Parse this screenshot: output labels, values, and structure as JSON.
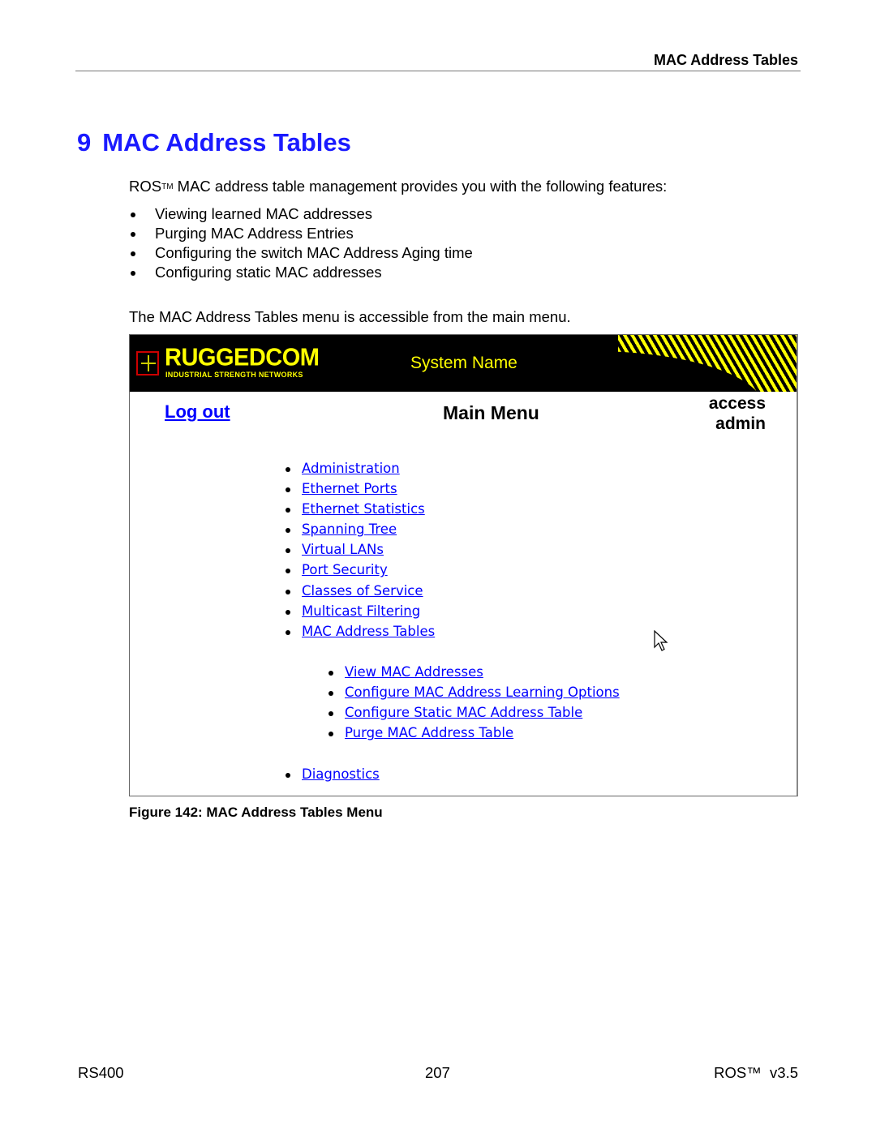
{
  "running_header": "MAC Address Tables",
  "chapter": {
    "number": "9",
    "title": "MAC Address Tables"
  },
  "intro": {
    "prefix": "ROS",
    "tm": "TM",
    "text": " MAC address table management provides you with the following features:"
  },
  "features": [
    "Viewing learned MAC addresses",
    "Purging MAC Address Entries",
    "Configuring the switch MAC Address Aging time",
    "Configuring static MAC addresses"
  ],
  "access_note": "The MAC Address Tables menu is accessible from the main menu.",
  "screenshot": {
    "logo": {
      "name": "RUGGEDCOM",
      "tagline": "INDUSTRIAL STRENGTH NETWORKS"
    },
    "system_name": "System Name",
    "logout": "Log out",
    "title": "Main Menu",
    "access_label": "access",
    "access_level": "admin",
    "menu": [
      "Administration",
      "Ethernet Ports",
      "Ethernet Statistics",
      "Spanning Tree",
      "Virtual LANs",
      "Port Security",
      "Classes of Service",
      "Multicast Filtering",
      "MAC Address Tables"
    ],
    "submenu": [
      "View MAC Addresses",
      "Configure MAC Address Learning Options",
      "Configure Static MAC Address Table",
      "Purge MAC Address Table"
    ],
    "menu_after": [
      "Diagnostics"
    ],
    "colors": {
      "header_bg": "#000000",
      "accent": "#ffff00",
      "link": "#0000ff"
    }
  },
  "caption": "Figure 142: MAC Address Tables Menu",
  "footer": {
    "left": "RS400",
    "center": "207",
    "right": "ROS™  v3.5"
  }
}
